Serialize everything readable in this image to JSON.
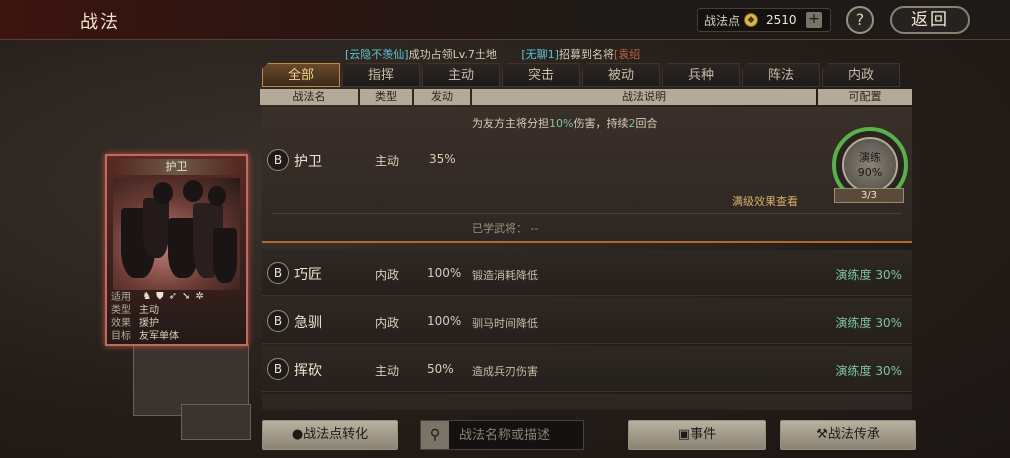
{
  "header": {
    "title": "战法",
    "points_label": "战法点",
    "points_value": "2510",
    "plus": "+",
    "help": "?",
    "back": "返回"
  },
  "ticker": {
    "part1": "[云隐不羡仙]",
    "part2": "成功占领Lv.7土地",
    "part3": "[无聊1]",
    "part4": "招募到名将",
    "part5": "[袁绍"
  },
  "tabs": [
    "全部",
    "指挥",
    "主动",
    "突击",
    "被动",
    "兵种",
    "阵法",
    "内政"
  ],
  "columns": [
    "战法名",
    "类型",
    "发动",
    "战法说明",
    "可配置"
  ],
  "selected": {
    "badge": "B",
    "name": "护卫",
    "type": "主动",
    "rate": "35%",
    "desc_pre": "为友方主将分担",
    "desc_hl1": "10%",
    "desc_mid": "伤害，持续",
    "desc_hl2": "2",
    "desc_post": "回合",
    "train_label": "演练",
    "train_pct": "90%",
    "train_count": "3/3",
    "full_effect": "满级效果查看",
    "learned": "已学武将：  --"
  },
  "skills": [
    {
      "badge": "B",
      "name": "巧匠",
      "type": "内政",
      "rate": "100%",
      "desc": "锻造消耗降低",
      "prof": "演练度 30%"
    },
    {
      "badge": "B",
      "name": "急驯",
      "type": "内政",
      "rate": "100%",
      "desc": "驯马时间降低",
      "prof": "演练度 30%"
    },
    {
      "badge": "B",
      "name": "挥砍",
      "type": "主动",
      "rate": "50%",
      "desc": "造成兵刃伤害",
      "prof": "演练度 30%"
    }
  ],
  "card": {
    "title": "护卫",
    "rows": [
      {
        "k": "适用",
        "v": ""
      },
      {
        "k": "类型",
        "v": "主动"
      },
      {
        "k": "效果",
        "v": "援护"
      },
      {
        "k": "目标",
        "v": "友军单体"
      }
    ]
  },
  "bottom": {
    "convert": "战法点转化",
    "search_placeholder": "战法名称或描述",
    "event": "事件",
    "inherit": "战法传承"
  }
}
